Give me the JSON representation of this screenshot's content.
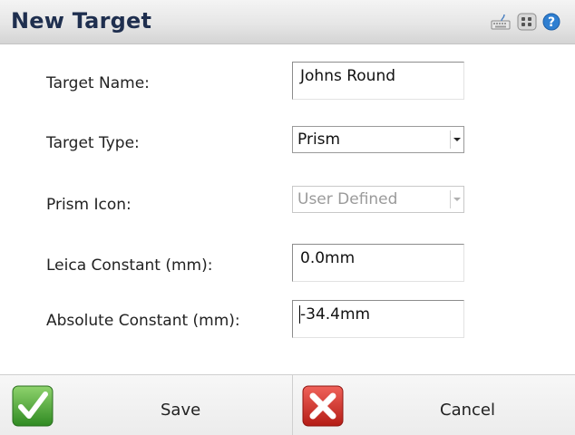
{
  "header": {
    "title": "New Target",
    "icons": [
      "keyboard-icon",
      "grid-menu-icon",
      "help-icon"
    ]
  },
  "form": {
    "target_name": {
      "label": "Target Name:",
      "value": "Johns Round"
    },
    "target_type": {
      "label": "Target Type:",
      "value": "Prism"
    },
    "prism_icon": {
      "label": "Prism Icon:",
      "value": "User Defined",
      "disabled": true
    },
    "leica_constant": {
      "label": "Leica Constant (mm):",
      "value": "0.0mm"
    },
    "absolute_constant": {
      "label": "Absolute Constant (mm):",
      "value": "-34.4mm"
    }
  },
  "footer": {
    "save_label": "Save",
    "cancel_label": "Cancel"
  },
  "colors": {
    "title_text": "#1f2f4f",
    "save_icon_bg": "#3a9b2c",
    "cancel_icon_bg": "#c9261f",
    "help_icon": "#2f7fd1"
  }
}
